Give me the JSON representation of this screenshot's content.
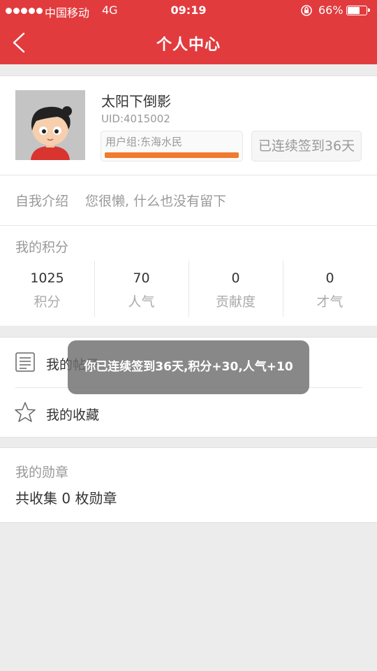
{
  "status_bar": {
    "carrier": "中国移动",
    "network": "4G",
    "time": "09:19",
    "battery_pct": "66%",
    "battery_level": 0.66
  },
  "nav": {
    "title": "个人中心",
    "back_icon": "chevron-left-icon"
  },
  "profile": {
    "username": "太阳下倒影",
    "uid": "UID:4015002",
    "group": "用户组:东海水民",
    "group_progress": 1.0,
    "checkin": "已连续签到36天",
    "progress_color": "#f07a2e"
  },
  "intro": {
    "label": "自我介绍",
    "text": "您很懒, 什么也没有留下"
  },
  "points": {
    "heading": "我的积分",
    "stats": [
      {
        "value": "1025",
        "label": "积分"
      },
      {
        "value": "70",
        "label": "人气"
      },
      {
        "value": "0",
        "label": "贡献度"
      },
      {
        "value": "0",
        "label": "才气"
      }
    ]
  },
  "menu": {
    "items": [
      {
        "label": "我的帖子",
        "icon": "document-icon"
      },
      {
        "label": "我的收藏",
        "icon": "star-icon"
      }
    ]
  },
  "medals": {
    "heading": "我的勋章",
    "count_text": "共收集 0 枚勋章"
  },
  "toast": {
    "text": "你已连续签到36天,积分+30,人气+10"
  },
  "colors": {
    "brand": "#e23b3e",
    "background": "#ececec"
  }
}
